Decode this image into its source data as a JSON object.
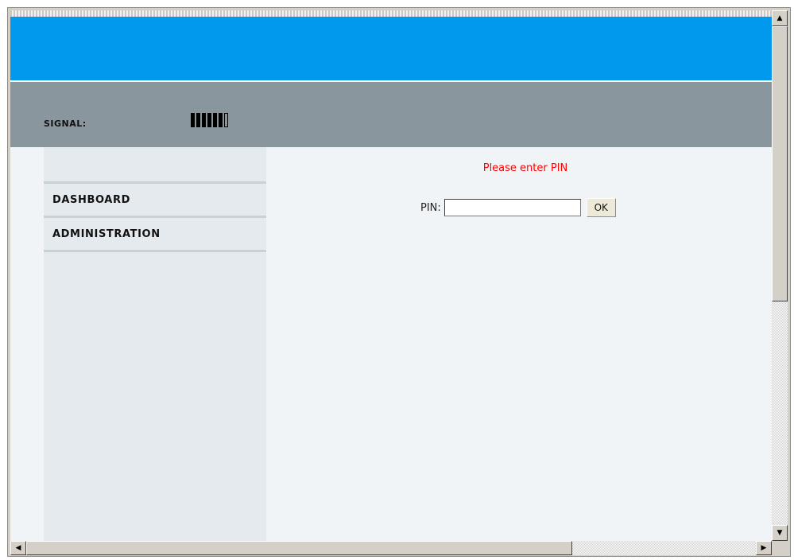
{
  "header": {
    "banner_color": "#0099ee",
    "status_bar_color": "#8a969e"
  },
  "signal": {
    "label": "SIGNAL:",
    "level": 6,
    "max": 7
  },
  "sidebar": {
    "items": [
      {
        "label": "DASHBOARD"
      },
      {
        "label": "ADMINISTRATION"
      }
    ]
  },
  "main": {
    "message": "Please enter PIN",
    "message_color": "#ff0000",
    "pin_label": "PIN:",
    "pin_value": "",
    "ok_label": "OK"
  },
  "scrollbars": {
    "up_icon": "arrow-up-icon",
    "down_icon": "arrow-down-icon",
    "left_icon": "arrow-left-icon",
    "right_icon": "arrow-right-icon"
  }
}
